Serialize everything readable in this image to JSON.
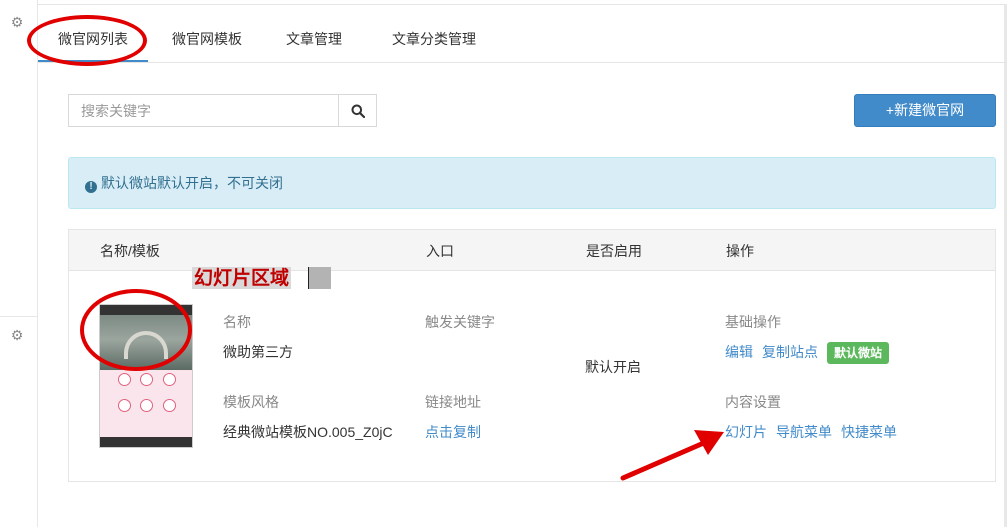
{
  "tabs": [
    {
      "label": "微官网列表",
      "active": true
    },
    {
      "label": "微官网模板"
    },
    {
      "label": "文章管理"
    },
    {
      "label": "文章分类管理"
    }
  ],
  "search": {
    "placeholder": "搜索关键字",
    "value": ""
  },
  "new_button": "+新建微官网",
  "alert": {
    "text": "默认微站默认开启，不可关闭"
  },
  "table": {
    "headers": [
      "名称/模板",
      "入口",
      "是否启用",
      "操作"
    ]
  },
  "row": {
    "annotation": "幻灯片区域",
    "name_label": "名称",
    "name_value": "微助第三方",
    "trigger_label": "触发关键字",
    "style_label": "模板风格",
    "style_value": "经典微站模板NO.005_Z0jC",
    "link_label": "链接地址",
    "link_action": "点击复制",
    "enabled": "默认开启",
    "basic_ops_label": "基础操作",
    "edit": "编辑",
    "copy_site": "复制站点",
    "default_badge": "默认微站",
    "content_label": "内容设置",
    "slides": "幻灯片",
    "nav_menu": "导航菜单",
    "quick_menu": "快捷菜单"
  },
  "colors": {
    "primary": "#428bca",
    "alert_bg": "#d9edf7",
    "alert_text": "#31708f",
    "badge_green": "#5cb85c",
    "annotation_red": "#e00000"
  }
}
